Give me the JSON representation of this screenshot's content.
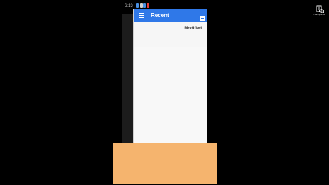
{
  "status_bar": {
    "time": "6:13",
    "icons": [
      "notification-icon-1",
      "notification-icon-2",
      "notification-icon-3",
      "notification-icon-4"
    ]
  },
  "app_bar": {
    "title": "Recent",
    "menu_icon": "menu-icon",
    "view_icon": "grid-view-icon",
    "color": "#2f78e8"
  },
  "list_header": {
    "sort_label": "Modified"
  },
  "colors": {
    "background": "#000000",
    "screen": "#f6f6f6",
    "overlay_block": "#f5b46e"
  },
  "watermark": {
    "icon": "app-logo-icon",
    "text": "File Opener"
  }
}
